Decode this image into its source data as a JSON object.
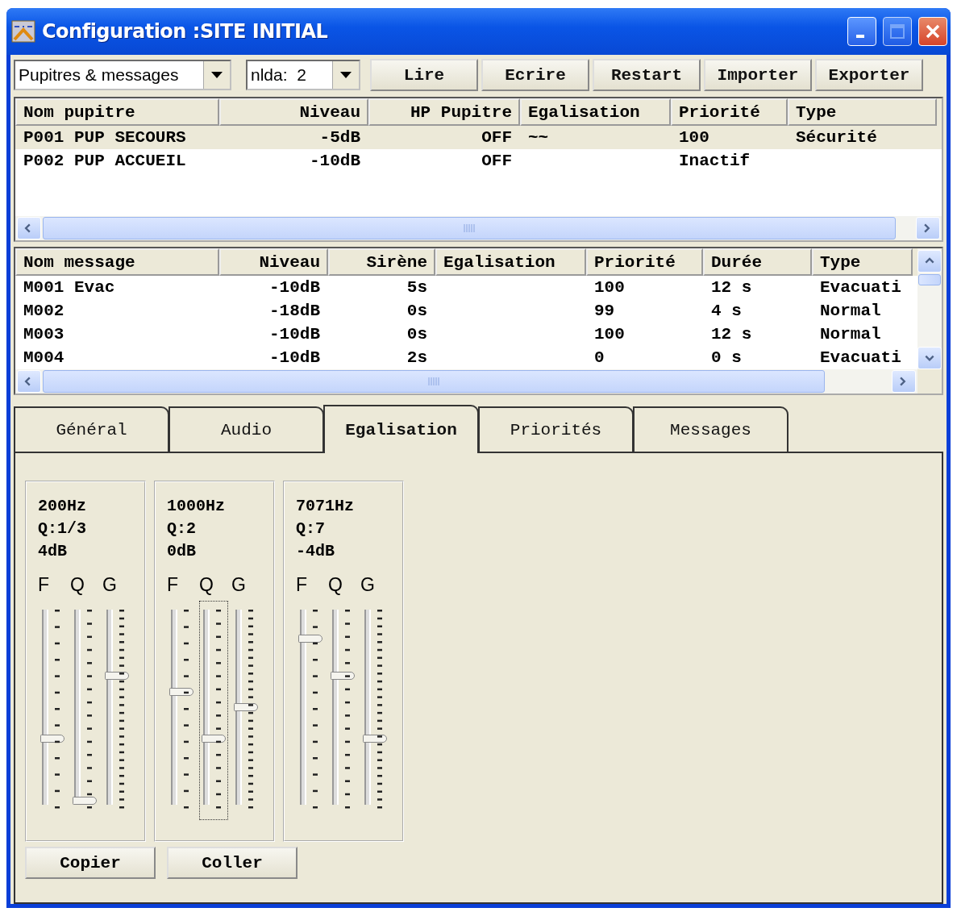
{
  "window": {
    "title": "Configuration :SITE INITIAL"
  },
  "toolbar": {
    "dropdowns": [
      {
        "value": "Pupitres & messages"
      },
      {
        "value": "nlda:  2"
      }
    ],
    "buttons": [
      "Lire",
      "Ecrire",
      "Restart",
      "Importer",
      "Exporter"
    ]
  },
  "desks_table": {
    "columns": [
      "Nom pupitre",
      "Niveau",
      "HP Pupitre",
      "Egalisation",
      "Priorité",
      "Type"
    ],
    "rows": [
      {
        "selected": true,
        "cells": [
          "P001 PUP SECOURS",
          "-5dB",
          "OFF",
          "~~",
          "100",
          "Sécurité"
        ]
      },
      {
        "selected": false,
        "cells": [
          "P002 PUP ACCUEIL",
          "-10dB",
          "OFF",
          null,
          "Inactif",
          null
        ]
      }
    ]
  },
  "messages_table": {
    "columns": [
      "Nom message",
      "Niveau",
      "Sirène",
      "Egalisation",
      "Priorité",
      "Durée",
      "Type"
    ],
    "rows": [
      {
        "selected": false,
        "cells": [
          "M001 Evac",
          "-10dB",
          "5s",
          null,
          "100",
          "12 s",
          "Evacuati"
        ]
      },
      {
        "selected": false,
        "cells": [
          "M002",
          "-18dB",
          "0s",
          null,
          "99",
          "4 s",
          "Normal"
        ]
      },
      {
        "selected": false,
        "cells": [
          "M003",
          "-10dB",
          "0s",
          null,
          "100",
          "12 s",
          "Normal"
        ]
      },
      {
        "selected": false,
        "cells": [
          "M004",
          "-10dB",
          "2s",
          null,
          "0",
          "0 s",
          "Evacuati"
        ]
      }
    ]
  },
  "tabs": [
    {
      "label": "Général",
      "selected": false
    },
    {
      "label": "Audio",
      "selected": false
    },
    {
      "label": "Egalisation",
      "selected": true
    },
    {
      "label": "Priorités",
      "selected": false
    },
    {
      "label": "Messages",
      "selected": false
    }
  ],
  "eq_bands": [
    {
      "frequency": "200Hz",
      "q": "Q:1/3",
      "gain": "4dB",
      "sliders": [
        {
          "label": "F",
          "level": 0.34,
          "focused": false
        },
        {
          "label": "Q",
          "level": 0.02,
          "focused": false
        },
        {
          "label": "G",
          "level": 0.66,
          "focused": false
        }
      ]
    },
    {
      "frequency": "1000Hz",
      "q": "Q:2",
      "gain": "0dB",
      "sliders": [
        {
          "label": "F",
          "level": 0.58,
          "focused": false
        },
        {
          "label": "Q",
          "level": 0.34,
          "focused": true
        },
        {
          "label": "G",
          "level": 0.5,
          "focused": false
        }
      ]
    },
    {
      "frequency": "7071Hz",
      "q": "Q:7",
      "gain": "-4dB",
      "sliders": [
        {
          "label": "F",
          "level": 0.85,
          "focused": false
        },
        {
          "label": "Q",
          "level": 0.66,
          "focused": false
        },
        {
          "label": "G",
          "level": 0.34,
          "focused": false
        }
      ]
    }
  ],
  "bottom_buttons": [
    "Copier",
    "Coller"
  ]
}
